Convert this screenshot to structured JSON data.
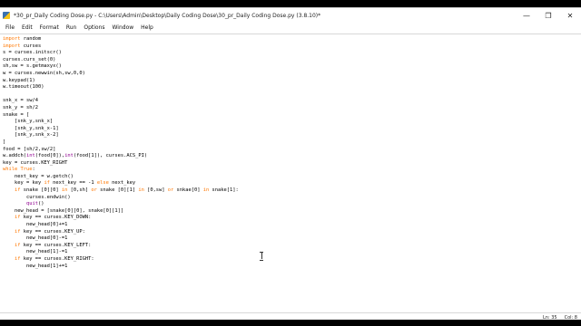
{
  "window": {
    "title": "*30_pr_Daily Coding Dose.py - C:\\Users\\Admin\\Desktop\\Daily Coding Dose\\30_pr_Daily Coding Dose.py (3.8.10)*",
    "minimize_icon": "minimize-icon",
    "maximize_icon": "restore-icon",
    "close_icon": "close-icon"
  },
  "menu": [
    "File",
    "Edit",
    "Format",
    "Run",
    "Options",
    "Window",
    "Help"
  ],
  "status": {
    "line": "Ln: 35",
    "col": "Col: 8"
  },
  "colors": {
    "keyword": "#ff7700",
    "builtin": "#900090",
    "text": "#000000"
  },
  "code_lines": [
    "import random",
    "import curses",
    "s = curses.initscr()",
    "curses.curs_set(0)",
    "sh,sw = s.getmaxyx()",
    "w = curses.newwin(sh,sw,0,0)",
    "w.keypad(1)",
    "w.timeout(100)",
    "",
    "snk_x = sw/4",
    "snk_y = sh/2",
    "snake = [",
    "    [snk_y,snk_x]",
    "    [snk_y,snk_x-1]",
    "    [snk_y,snk_x-2]",
    "]",
    "food = [sh/2,sw/2]",
    "w.addch(int(food[0]),int(food[1]), curses.ACS_PI)",
    "key = curses.KEY_RIGHT",
    "while True:",
    "    next_key = w.getch()",
    "    key = key if next_key == -1 else next_key",
    "    if snake [0][0] in [0,sh] or snake [0][1] in [0,sw] or snkae[0] in snake[1]:",
    "        curses.endwin()",
    "        quit()",
    "    new_head = [snake[0][0], snake[0][1]]",
    "    if key == curses.KEY_DOWN:",
    "        new_head[0]+=1",
    "    if key == curses.KEY_UP:",
    "        new_head[0]-=1",
    "    if key == curses.KEY_LEFT:",
    "        new_head[1]-=1",
    "    if key == curses.KEY_RIGHT:",
    "        new_head[1]+=1"
  ]
}
